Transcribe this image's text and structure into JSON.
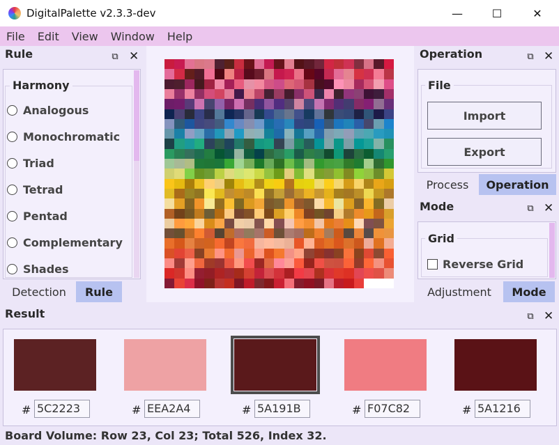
{
  "window": {
    "title": "DigitalPalette v2.3.3-dev",
    "minimize": "—",
    "maximize": "☐",
    "close": "✕"
  },
  "menu": [
    "File",
    "Edit",
    "View",
    "Window",
    "Help"
  ],
  "rule_panel": {
    "title": "Rule",
    "group": "Harmony",
    "options": [
      "Analogous",
      "Monochromatic",
      "Triad",
      "Tetrad",
      "Pentad",
      "Complementary",
      "Shades"
    ],
    "tabs": [
      "Detection",
      "Rule"
    ],
    "active_tab": "Rule"
  },
  "operation_panel": {
    "title": "Operation",
    "group": "File",
    "buttons": [
      "Import",
      "Export"
    ],
    "tabs": [
      "Process",
      "Operation"
    ],
    "active_tab": "Operation"
  },
  "mode_panel": {
    "title": "Mode",
    "group": "Grid",
    "checkbox": "Reverse Grid",
    "tabs": [
      "Adjustment",
      "Mode"
    ],
    "active_tab": "Mode"
  },
  "result_panel": {
    "title": "Result",
    "hash": "#",
    "swatches": [
      {
        "hex": "5C2223",
        "color": "#5c2223"
      },
      {
        "hex": "EEA2A4",
        "color": "#eea2a4"
      },
      {
        "hex": "5A191B",
        "color": "#5a191b",
        "selected": true
      },
      {
        "hex": "F07C82",
        "color": "#f07c82"
      },
      {
        "hex": "5A1216",
        "color": "#5a1216"
      }
    ]
  },
  "board": {
    "rows": 23,
    "cols": 23
  },
  "status": "Board Volume: Row 23, Col 23; Total 526, Index 32.",
  "icons": {
    "float": "restore-icon",
    "close": "close-icon"
  }
}
